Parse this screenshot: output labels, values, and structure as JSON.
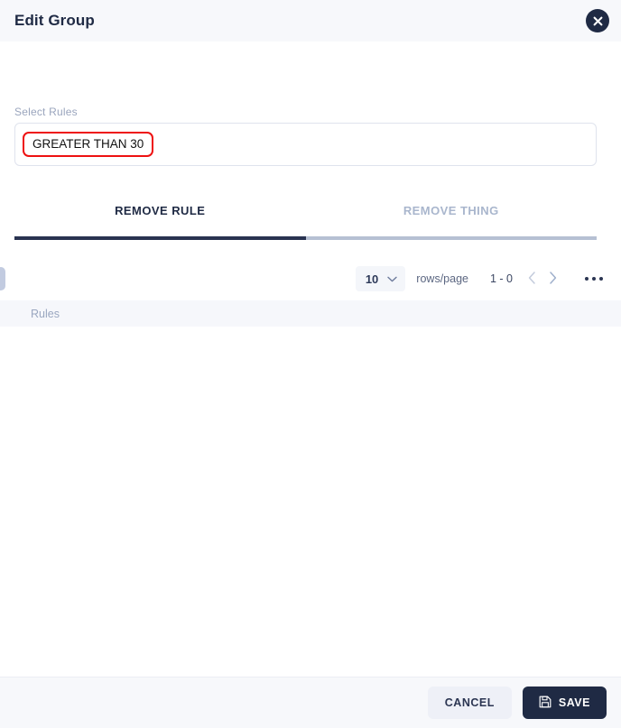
{
  "dialog": {
    "title": "Edit Group",
    "close_icon": "close-icon"
  },
  "form": {
    "select_rules_label": "Select Rules",
    "selected_chips": [
      {
        "label": "GREATER THAN 30",
        "border_color": "#ee1111"
      }
    ]
  },
  "tabs": [
    {
      "label": "REMOVE RULE",
      "active": true
    },
    {
      "label": "REMOVE THING",
      "active": false
    }
  ],
  "toolbar": {
    "rows_per_page_value": "10",
    "rows_per_page_label": "rows/page",
    "range_label": "1 - 0",
    "prev_icon": "chevron-left-icon",
    "next_icon": "chevron-right-icon",
    "overflow_icon": "ellipsis-horizontal-icon"
  },
  "table": {
    "columns": [
      "Rules"
    ],
    "rows": []
  },
  "footer": {
    "cancel_label": "CANCEL",
    "save_label": "SAVE",
    "save_icon": "save-disk-icon"
  },
  "colors": {
    "accent_dark": "#1f2a44",
    "header_bg": "#f7f8fb",
    "chip_border": "#ee1111",
    "tab_inactive": "#a9b6cd"
  }
}
